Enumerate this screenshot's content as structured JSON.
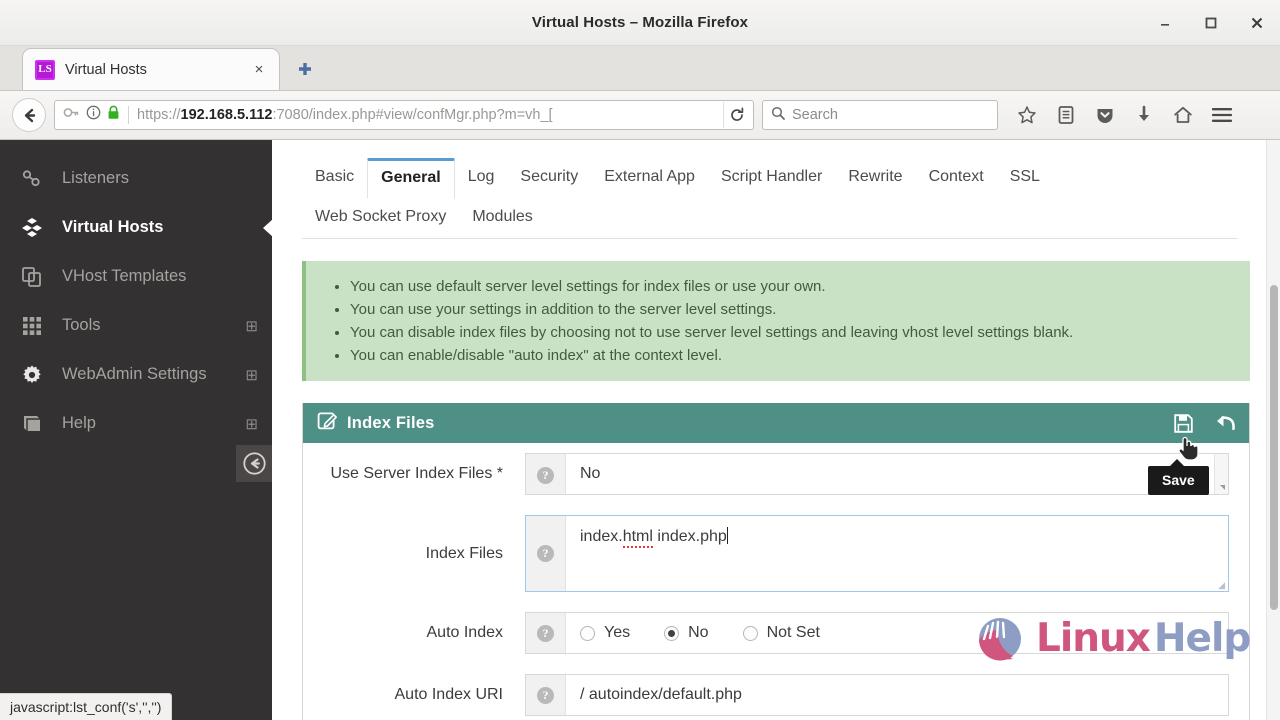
{
  "window": {
    "title": "Virtual Hosts – Mozilla Firefox",
    "minimize_label": "–",
    "maximize_label": "□",
    "close_label": "×"
  },
  "browser": {
    "tab": {
      "favicon_label": "LS",
      "title": "Virtual Hosts",
      "close_label": "×"
    },
    "new_tab_label": "+",
    "url": {
      "scheme": "https://",
      "host": "192.168.5.112",
      "rest": ":7080/index.php#view/confMgr.php?m=vh_[",
      "full": "https://192.168.5.112:7080/index.php#view/confMgr.php?m=vh_["
    },
    "reload_label": "⟳",
    "search": {
      "placeholder": "Search"
    },
    "icons": {
      "back": "back-arrow-icon",
      "key": "key-icon",
      "info": "info-icon",
      "lock": "padlock-icon",
      "search": "search-icon",
      "bookmark": "star-icon",
      "library": "library-icon",
      "pocket": "pocket-icon",
      "downloads": "download-arrow-icon",
      "home": "home-icon",
      "menu": "hamburger-menu-icon"
    }
  },
  "sidebar": {
    "items": [
      {
        "label": "Listeners",
        "icon": "listeners-icon",
        "active": false,
        "expandable": false
      },
      {
        "label": "Virtual Hosts",
        "icon": "virtual-hosts-icon",
        "active": true,
        "expandable": false
      },
      {
        "label": "VHost Templates",
        "icon": "vhost-templates-icon",
        "active": false,
        "expandable": false
      },
      {
        "label": "Tools",
        "icon": "grid-icon",
        "active": false,
        "expandable": true
      },
      {
        "label": "WebAdmin Settings",
        "icon": "gear-icon",
        "active": false,
        "expandable": true
      },
      {
        "label": "Help",
        "icon": "book-icon",
        "active": false,
        "expandable": true
      }
    ],
    "expand_symbol": "⊞",
    "collapse_button": "collapse-sidebar-icon"
  },
  "page_tabs": [
    {
      "label": "Basic",
      "active": false
    },
    {
      "label": "General",
      "active": true
    },
    {
      "label": "Log",
      "active": false
    },
    {
      "label": "Security",
      "active": false
    },
    {
      "label": "External App",
      "active": false
    },
    {
      "label": "Script Handler",
      "active": false
    },
    {
      "label": "Rewrite",
      "active": false
    },
    {
      "label": "Context",
      "active": false
    },
    {
      "label": "SSL",
      "active": false
    },
    {
      "label": "Web Socket Proxy",
      "active": false
    },
    {
      "label": "Modules",
      "active": false
    }
  ],
  "notice": {
    "bullets": [
      "You can use default server level settings for index files or use your own.",
      "You can use your settings in addition to the server level settings.",
      "You can disable index files by choosing not to use server level settings and leaving vhost level settings blank.",
      "You can enable/disable \"auto index\" at the context level."
    ],
    "bg_color": "#c9e2c5",
    "accent_color": "#8cc182"
  },
  "panel": {
    "title": "Index Files",
    "title_icon": "edit-square-icon",
    "header_color": "#4f9086",
    "actions": [
      {
        "name": "save-icon",
        "tooltip": "Save"
      },
      {
        "name": "undo-icon",
        "tooltip": ""
      }
    ],
    "tooltip_text": "Save",
    "help_symbol": "?",
    "fields": [
      {
        "label": "Use Server Index Files *",
        "type": "select",
        "value": "No"
      },
      {
        "label": "Index Files",
        "type": "textarea",
        "value": "index.html index.php",
        "misspelled_fragment": "html",
        "focused": true
      },
      {
        "label": "Auto Index",
        "type": "radio",
        "options": [
          "Yes",
          "No",
          "Not Set"
        ],
        "selected": "No"
      },
      {
        "label": "Auto Index URI",
        "type": "text",
        "value": "/ autoindex/default.php"
      }
    ]
  },
  "watermark": {
    "part1": "Linux",
    "part2": "Help",
    "color1": "#d0557f",
    "color2": "#8d9dc4",
    "logo_icon": "linuxhelp-hand-logo-icon"
  },
  "statusbar": {
    "text": "javascript:lst_conf('s','','')"
  }
}
